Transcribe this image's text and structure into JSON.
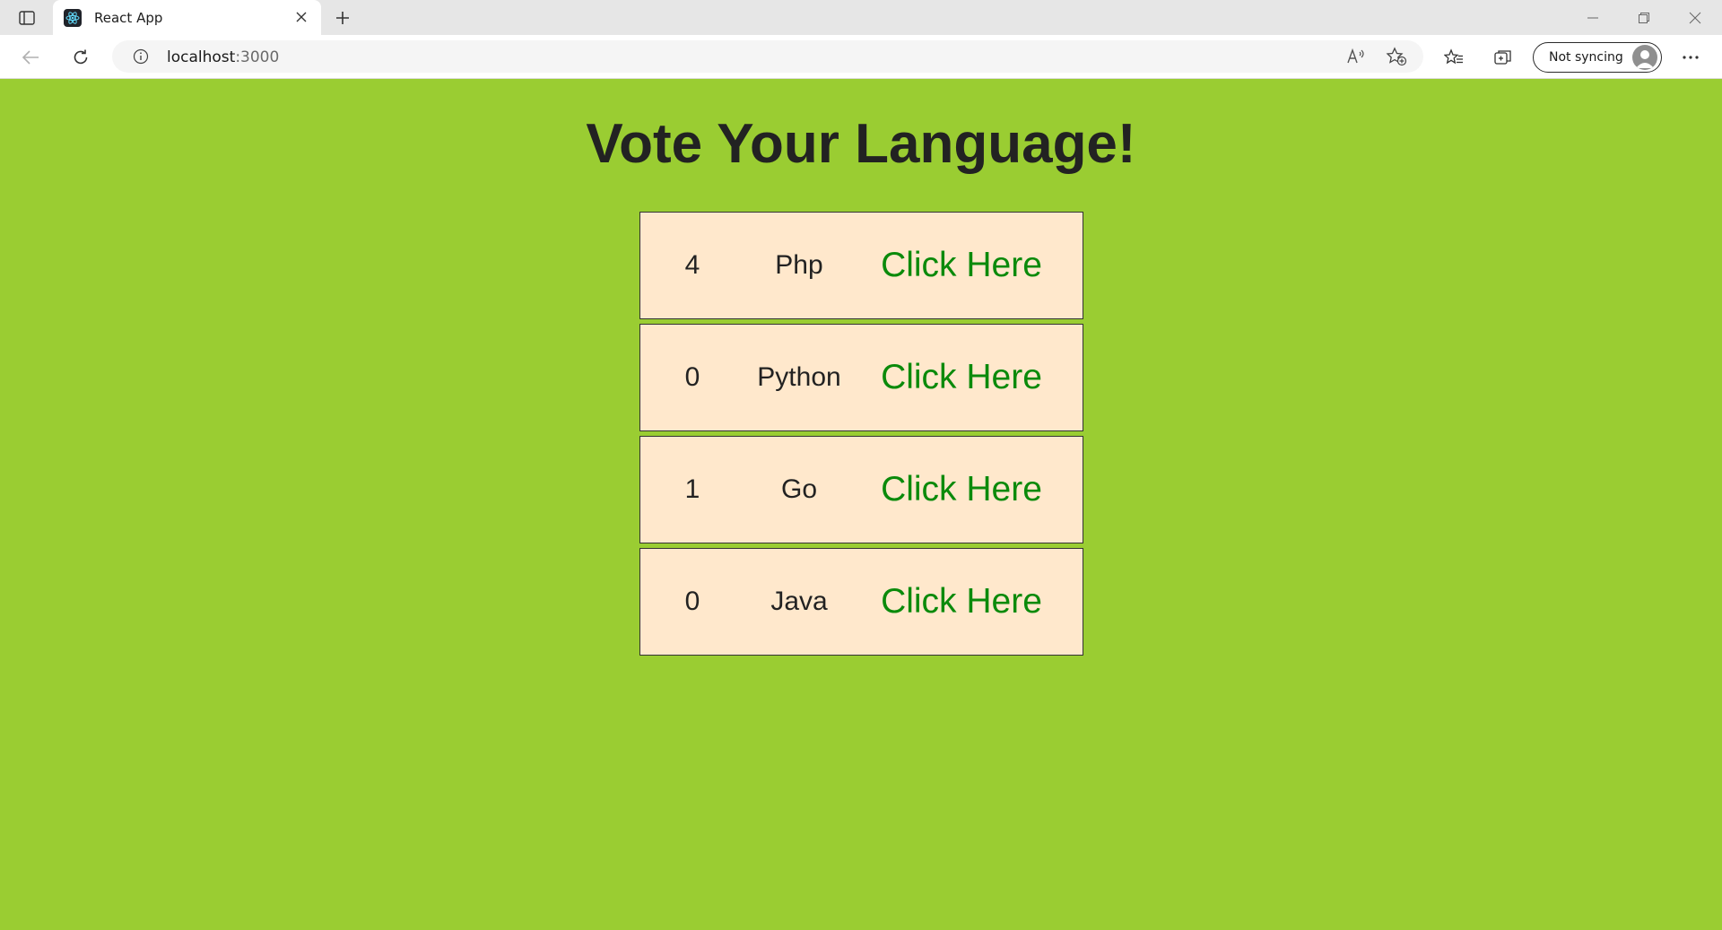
{
  "browser": {
    "tab_title": "React App",
    "url_host": "localhost",
    "url_port": ":3000",
    "sync_label": "Not syncing"
  },
  "page": {
    "title": "Vote Your Language!",
    "background": "#9acd32",
    "row_background": "#ffe8cc",
    "button_color": "#0b8a0b"
  },
  "votes": [
    {
      "count": "4",
      "language": "Php",
      "button": "Click Here"
    },
    {
      "count": "0",
      "language": "Python",
      "button": "Click Here"
    },
    {
      "count": "1",
      "language": "Go",
      "button": "Click Here"
    },
    {
      "count": "0",
      "language": "Java",
      "button": "Click Here"
    }
  ]
}
